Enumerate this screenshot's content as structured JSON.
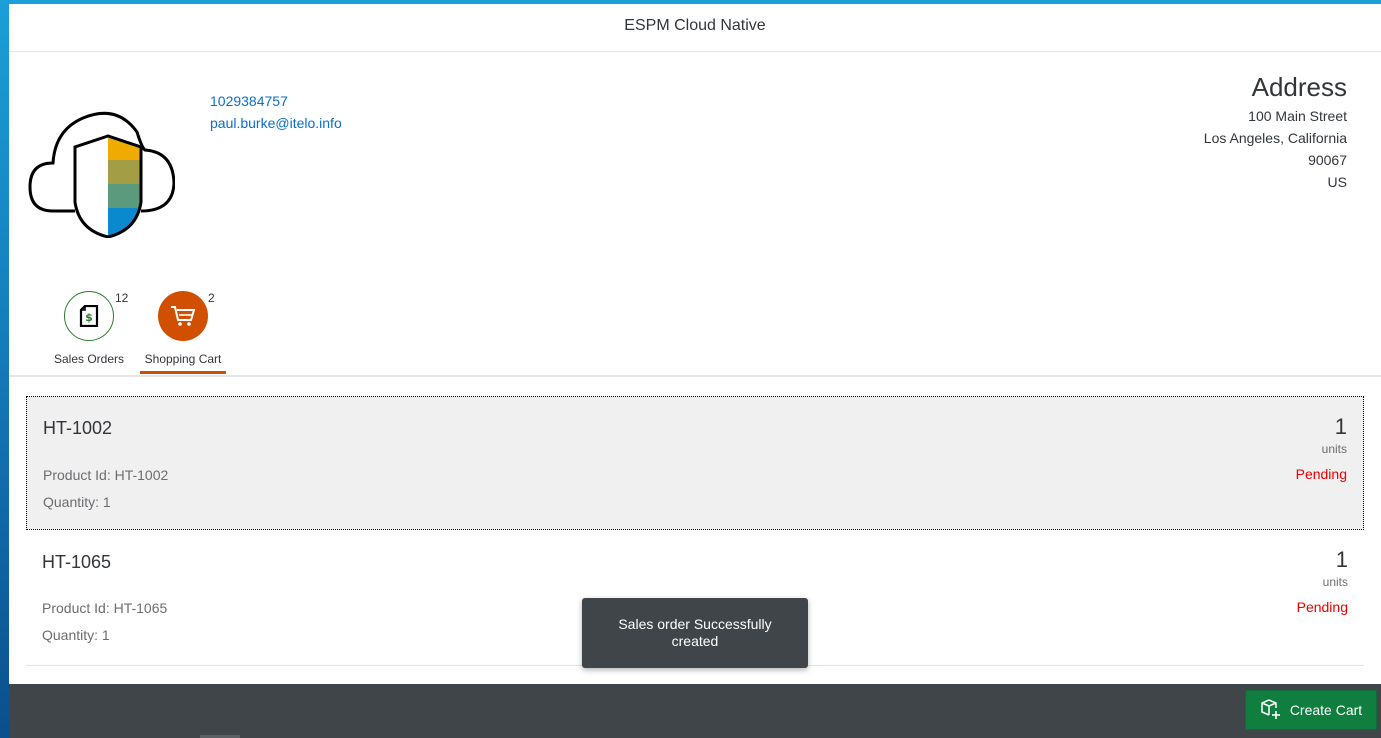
{
  "shell": {
    "title": "ESPM Cloud Native"
  },
  "customer": {
    "phone": "1029384757",
    "email": "paul.burke@itelo.info"
  },
  "address": {
    "title": "Address",
    "street": "100 Main Street",
    "city_state": "Los Angeles, California",
    "zip": "90067",
    "country": "US"
  },
  "tabs": [
    {
      "label": "Sales Orders",
      "count": "12",
      "icon": "sales-order-icon",
      "selected": false
    },
    {
      "label": "Shopping Cart",
      "count": "2",
      "icon": "cart-icon",
      "selected": true
    }
  ],
  "cart_items": [
    {
      "title": "HT-1002",
      "product_id": "Product Id: HT-1002",
      "quantity": "Quantity: 1",
      "number": "1",
      "unit": "units",
      "status": "Pending"
    },
    {
      "title": "HT-1065",
      "product_id": "Product Id: HT-1065",
      "quantity": "Quantity: 1",
      "number": "1",
      "unit": "units",
      "status": "Pending"
    }
  ],
  "toast": {
    "message": "Sales order Successfully created"
  },
  "footer": {
    "create_cart_label": "Create Cart",
    "create_cart_icon": "create-cart-icon"
  },
  "colors": {
    "accent": "#0a6ed1",
    "cart_orange": "#d04f00",
    "status_red": "#e00000",
    "button_green": "#107e3e",
    "footer_dark": "#3f4548"
  }
}
